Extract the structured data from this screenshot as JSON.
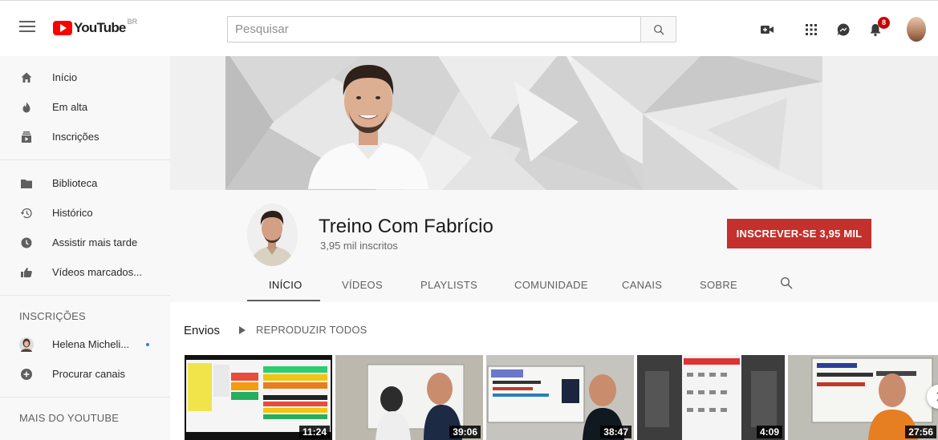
{
  "topbar": {
    "logo_text": "YouTube",
    "logo_country": "BR",
    "search_placeholder": "Pesquisar",
    "notification_count": "8",
    "icons": [
      "menu-icon",
      "search-icon",
      "create-video-icon",
      "apps-icon",
      "messages-icon",
      "notifications-icon",
      "account-avatar"
    ]
  },
  "sidebar": {
    "main": [
      {
        "icon": "home-icon",
        "label": "Início"
      },
      {
        "icon": "trending-icon",
        "label": "Em alta"
      },
      {
        "icon": "subscriptions-icon",
        "label": "Inscrições"
      }
    ],
    "library": [
      {
        "icon": "library-icon",
        "label": "Biblioteca"
      },
      {
        "icon": "history-icon",
        "label": "Histórico"
      },
      {
        "icon": "watch-later-icon",
        "label": "Assistir mais tarde"
      },
      {
        "icon": "liked-videos-icon",
        "label": "Vídeos marcados..."
      }
    ],
    "subscriptions_title": "INSCRIÇÕES",
    "subscriptions": [
      {
        "icon": "channel-avatar",
        "label": "Helena Micheli..."
      },
      {
        "icon": "add-channel-icon",
        "label": "Procurar canais"
      }
    ],
    "more_title": "MAIS DO YOUTUBE"
  },
  "channel": {
    "name": "Treino Com Fabrício",
    "subscribers": "3,95 mil inscritos",
    "subscribe_label": "INSCREVER-SE 3,95 MIL",
    "tabs": [
      "INÍCIO",
      "VÍDEOS",
      "PLAYLISTS",
      "COMUNIDADE",
      "CANAIS",
      "SOBRE"
    ],
    "active_tab": "INÍCIO"
  },
  "uploads": {
    "title": "Envios",
    "play_all": "REPRODUZIR TODOS",
    "videos": [
      {
        "duration": "11:24"
      },
      {
        "duration": "39:06"
      },
      {
        "duration": "38:47"
      },
      {
        "duration": "4:09"
      },
      {
        "duration": "27:56"
      }
    ]
  },
  "colors": {
    "accent": "#cc0000",
    "subscribe": "#c4302b",
    "sidebar_bg": "#f8f8f8"
  }
}
